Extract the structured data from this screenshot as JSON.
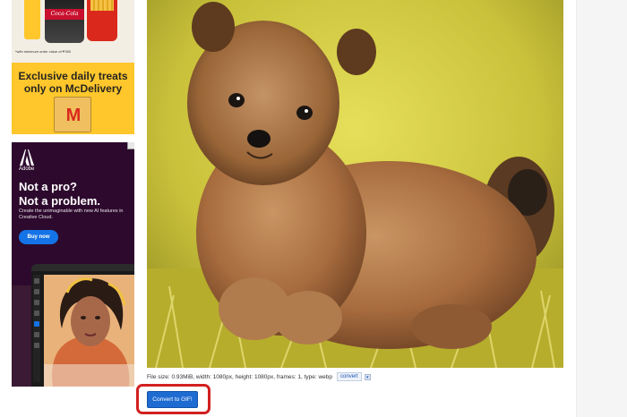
{
  "ads": {
    "mcdelivery": {
      "cup_brand": "Coca-Cola",
      "fine_print": "*with minimum order value of ₱350",
      "headline_line1": "Exclusive daily treats",
      "headline_line2": "only on McDelivery",
      "colors": {
        "yellow": "#ffc72c",
        "red": "#da291c"
      }
    },
    "adobe": {
      "brand": "Adobe",
      "headline_line1": "Not a pro?",
      "headline_line2": "Not a problem.",
      "body": "Create the unimaginable with new AI features in Creative Cloud.",
      "buy_label": "Buy now",
      "colors": {
        "background": "#2d0a2d",
        "button": "#1473e6"
      }
    }
  },
  "preview": {
    "alt": "Pomeranian puppy sitting in grass",
    "file_info": "File size: 0.93MiB, width: 1080px, height: 1080px, frames: 1, type: webp",
    "convert_link": "convert",
    "convert_arrow": "▾"
  },
  "actions": {
    "convert_button": "Convert to GIF!",
    "highlight_color": "#d21f1f",
    "button_color": "#1e6bd1"
  }
}
